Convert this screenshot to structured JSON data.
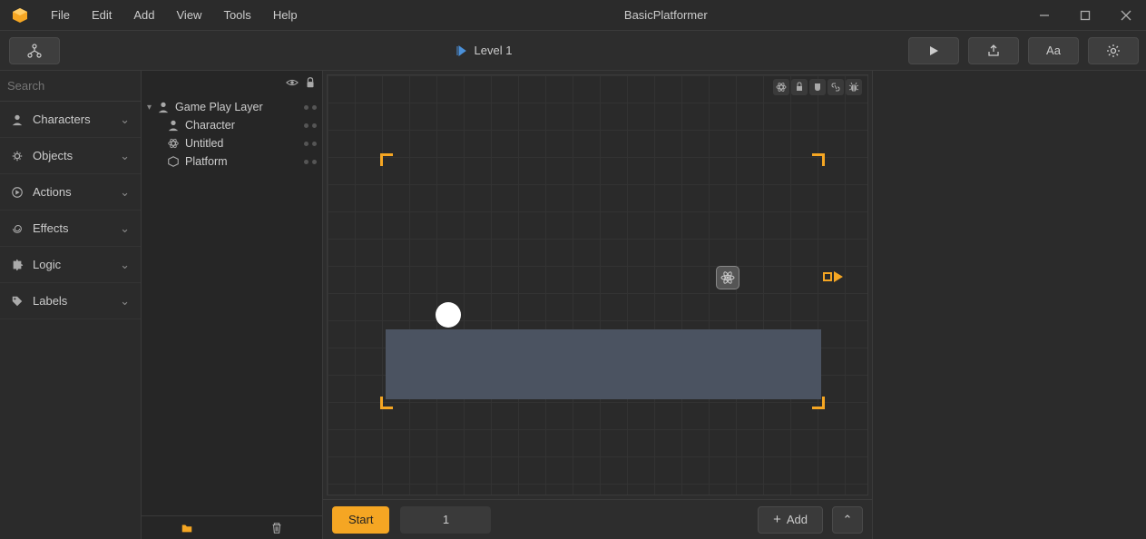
{
  "window": {
    "title": "BasicPlatformer",
    "menu": [
      "File",
      "Edit",
      "Add",
      "View",
      "Tools",
      "Help"
    ]
  },
  "toolbar": {
    "scene_label": "Level 1"
  },
  "sidebar": {
    "search_placeholder": "Search",
    "categories": [
      {
        "label": "Characters"
      },
      {
        "label": "Objects"
      },
      {
        "label": "Actions"
      },
      {
        "label": "Effects"
      },
      {
        "label": "Logic"
      },
      {
        "label": "Labels"
      }
    ]
  },
  "outline": {
    "layer_label": "Game Play Layer",
    "items": [
      {
        "label": "Character"
      },
      {
        "label": "Untitled"
      },
      {
        "label": "Platform"
      }
    ]
  },
  "footer": {
    "start_label": "Start",
    "frame_number": "1",
    "add_label": "Add"
  }
}
